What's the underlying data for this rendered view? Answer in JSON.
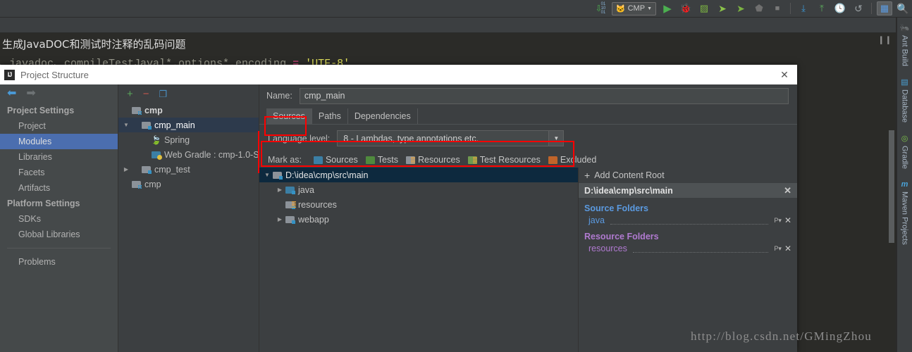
{
  "ide": {
    "run_config": {
      "label": "CMP",
      "icon": "cat-icon"
    },
    "toolbar_icons": [
      {
        "name": "update-project-icon",
        "glyph": "⇩"
      },
      {
        "name": "run-icon",
        "glyph": "▶"
      },
      {
        "name": "debug-icon",
        "glyph": "🐞"
      },
      {
        "name": "coverage-icon",
        "glyph": "▨"
      },
      {
        "name": "run-jrebel-icon",
        "glyph": "➤"
      },
      {
        "name": "debug-jrebel-icon",
        "glyph": "➤"
      },
      {
        "name": "build-icon",
        "glyph": "⬟"
      },
      {
        "name": "stop-icon",
        "glyph": "■"
      },
      {
        "name": "vcs-update-icon",
        "glyph": "⤓"
      },
      {
        "name": "vcs-commit-icon",
        "glyph": "⤒"
      },
      {
        "name": "vcs-history-icon",
        "glyph": "🕓"
      },
      {
        "name": "undo-icon",
        "glyph": "↺"
      },
      {
        "name": "project-structure-icon",
        "glyph": "▦"
      },
      {
        "name": "search-everywhere-icon",
        "glyph": "🔍"
      }
    ],
    "editor": {
      "chinese_line": "、生成JavaDOC和测试时注释的乱码问题",
      "code_line_prefix": "va、javadoc、compileTestJaval*.options*.encoding ",
      "code_line_eq": "= ",
      "code_line_str": "'UTF-8'"
    },
    "right_tabs": [
      {
        "label": "Ant Build",
        "icon": "ant-icon",
        "glyph": "🐜"
      },
      {
        "label": "Database",
        "icon": "database-icon",
        "glyph": "▤"
      },
      {
        "label": "Gradle",
        "icon": "gradle-icon",
        "glyph": "◎"
      },
      {
        "label": "Maven Projects",
        "icon": "maven-icon",
        "glyph": "m"
      }
    ],
    "watermark": "http://blog.csdn.net/GMingZhou"
  },
  "dialog": {
    "title": "Project Structure",
    "close_label": "✕",
    "nav": {
      "back_arrow": "⬅",
      "forward_arrow": "➡",
      "groups": [
        {
          "label": "Project Settings",
          "items": [
            {
              "label": "Project",
              "selected": false
            },
            {
              "label": "Modules",
              "selected": true
            },
            {
              "label": "Libraries",
              "selected": false
            },
            {
              "label": "Facets",
              "selected": false
            },
            {
              "label": "Artifacts",
              "selected": false
            }
          ]
        },
        {
          "label": "Platform Settings",
          "items": [
            {
              "label": "SDKs",
              "selected": false
            },
            {
              "label": "Global Libraries",
              "selected": false
            }
          ]
        }
      ],
      "problems_label": "Problems"
    },
    "modules_toolbar": [
      {
        "name": "add-module-button",
        "glyph": "+",
        "color": "#5aa65a"
      },
      {
        "name": "remove-module-button",
        "glyph": "−",
        "color": "#c9584f"
      },
      {
        "name": "copy-module-button",
        "glyph": "❐",
        "color": "#4a90c4"
      }
    ],
    "module_tree": [
      {
        "label": "cmp",
        "indent": 0,
        "twisty": "",
        "icon": "module-group-icon",
        "selected": false,
        "bold": true
      },
      {
        "label": "cmp_main",
        "indent": 0,
        "twisty": "▼",
        "icon": "module-icon",
        "selected": true,
        "bold": false
      },
      {
        "label": "Spring",
        "indent": 2,
        "twisty": "",
        "icon": "spring-icon",
        "selected": false,
        "bold": false
      },
      {
        "label": "Web Gradle : cmp-1.0-S",
        "indent": 2,
        "twisty": "",
        "icon": "web-gradle-icon",
        "selected": false,
        "bold": false
      },
      {
        "label": "cmp_test",
        "indent": 0,
        "twisty": "▶",
        "icon": "module-icon",
        "selected": false,
        "bold": false
      },
      {
        "label": "cmp",
        "indent": 0,
        "twisty": "",
        "icon": "module-group-icon",
        "selected": false,
        "bold": false
      }
    ],
    "name_field": {
      "label": "Name:",
      "value": "cmp_main",
      "placeholder": ""
    },
    "tabs": [
      {
        "label": "Sources",
        "selected": true
      },
      {
        "label": "Paths",
        "selected": false
      },
      {
        "label": "Dependencies",
        "selected": false
      }
    ],
    "language_level": {
      "label": "Language level:",
      "value": "8 - Lambdas, type annotations etc.",
      "arrow": "▼"
    },
    "mark_as": {
      "label": "Mark as:",
      "options": [
        {
          "label": "Sources",
          "color": "#3b7fa5",
          "lines": false
        },
        {
          "label": "Tests",
          "color": "#4f8a3d",
          "lines": false
        },
        {
          "label": "Resources",
          "color": "#8c9299",
          "lines": true
        },
        {
          "label": "Test Resources",
          "color": "#6f9a4f",
          "lines": true
        },
        {
          "label": "Excluded",
          "color": "#c0642a",
          "lines": false
        }
      ]
    },
    "folder_tree": [
      {
        "label": "D:\\idea\\cmp\\src\\main",
        "indent": 0,
        "twisty": "▼",
        "color": "#8c9299",
        "lines": false,
        "selected": true
      },
      {
        "label": "java",
        "indent": 1,
        "twisty": "▶",
        "color": "#3b7fa5",
        "lines": false,
        "selected": false
      },
      {
        "label": "resources",
        "indent": 1,
        "twisty": "",
        "color": "#8c9299",
        "lines": true,
        "selected": false
      },
      {
        "label": "webapp",
        "indent": 1,
        "twisty": "▶",
        "color": "#8c9299",
        "lines": false,
        "selected": false
      }
    ],
    "content_roots": {
      "add_label": "Add Content Root",
      "add_glyph": "+",
      "root_path": "D:\\idea\\cmp\\src\\main",
      "root_close": "✕",
      "sections": [
        {
          "title": "Source Folders",
          "kind": "src",
          "entries": [
            {
              "name": "java",
              "pkg": "P",
              "close": "✕"
            }
          ]
        },
        {
          "title": "Resource Folders",
          "kind": "res",
          "entries": [
            {
              "name": "resources",
              "pkg": "P",
              "close": "✕"
            }
          ]
        }
      ]
    }
  }
}
